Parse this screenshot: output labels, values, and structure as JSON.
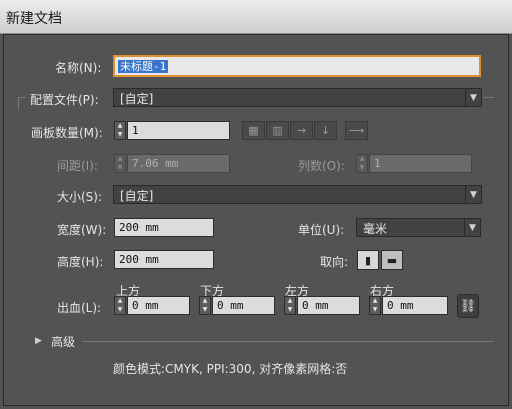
{
  "window": {
    "title": "新建文档"
  },
  "name": {
    "label": "名称(N):",
    "value": "未标题-1"
  },
  "profile": {
    "label": "配置文件(P):",
    "value": "[自定]"
  },
  "artboards": {
    "count_label": "画板数量(M):",
    "count_value": "1",
    "spacing_label": "间距(I):",
    "spacing_value": "7.06 mm",
    "columns_label": "列数(O):",
    "columns_value": "1",
    "arrange_icons": [
      "grid-by-row-icon",
      "grid-by-column-icon",
      "arrange-by-row-icon",
      "arrange-by-column-icon"
    ],
    "direction_icon": "right-to-left-icon"
  },
  "size": {
    "label": "大小(S):",
    "value": "[自定]"
  },
  "width": {
    "label": "宽度(W):",
    "value": "200 mm"
  },
  "units": {
    "label": "单位(U):",
    "value": "毫米"
  },
  "height": {
    "label": "高度(H):",
    "value": "200 mm"
  },
  "orientation": {
    "label": "取向:",
    "portrait_icon": "portrait-icon",
    "landscape_icon": "landscape-icon"
  },
  "bleed": {
    "label": "出血(L):",
    "top_label": "上方",
    "top_value": "0 mm",
    "bottom_label": "下方",
    "bottom_value": "0 mm",
    "left_label": "左方",
    "left_value": "0 mm",
    "right_label": "右方",
    "right_value": "0 mm",
    "link_icon": "chain-link-icon"
  },
  "advanced": {
    "label": "高级",
    "summary": "颜色模式:CMYK, PPI:300, 对齐像素网格:否"
  },
  "colors": {
    "accent": "#e09030",
    "selection": "#3a74c9",
    "panel": "#535353"
  }
}
